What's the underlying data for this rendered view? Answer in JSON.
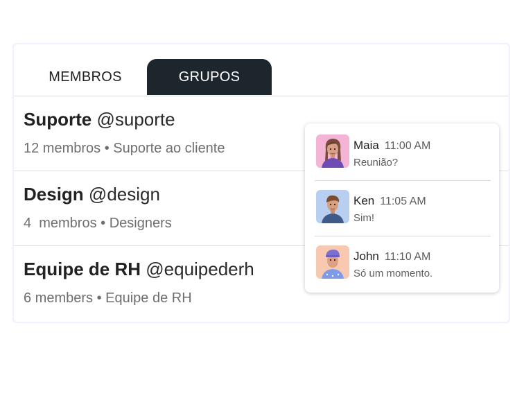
{
  "tabs": {
    "members_label": "MEMBROS",
    "groups_label": "GRUPOS"
  },
  "groups": [
    {
      "name": "Suporte",
      "handle": "@suporte",
      "subtitle": "12 membros • Suporte ao cliente"
    },
    {
      "name": "Design",
      "handle": "@design",
      "subtitle": "4  membros • Designers"
    },
    {
      "name": "Equipe de RH",
      "handle": "@equipederh",
      "subtitle": "6 members • Equipe de RH"
    }
  ],
  "messages": [
    {
      "author": "Maia",
      "time": "11:00 AM",
      "text": "Reunião?",
      "avatar_color": "#f3b4d6"
    },
    {
      "author": "Ken",
      "time": "11:05 AM",
      "text": "Sim!",
      "avatar_color": "#b9cff2"
    },
    {
      "author": "John",
      "time": "11:10 AM",
      "text": "Só um momento.",
      "avatar_color": "#f9c8b0"
    }
  ],
  "colors": {
    "active_tab_bg": "#1d262d",
    "card_border": "#f1f1fb"
  }
}
